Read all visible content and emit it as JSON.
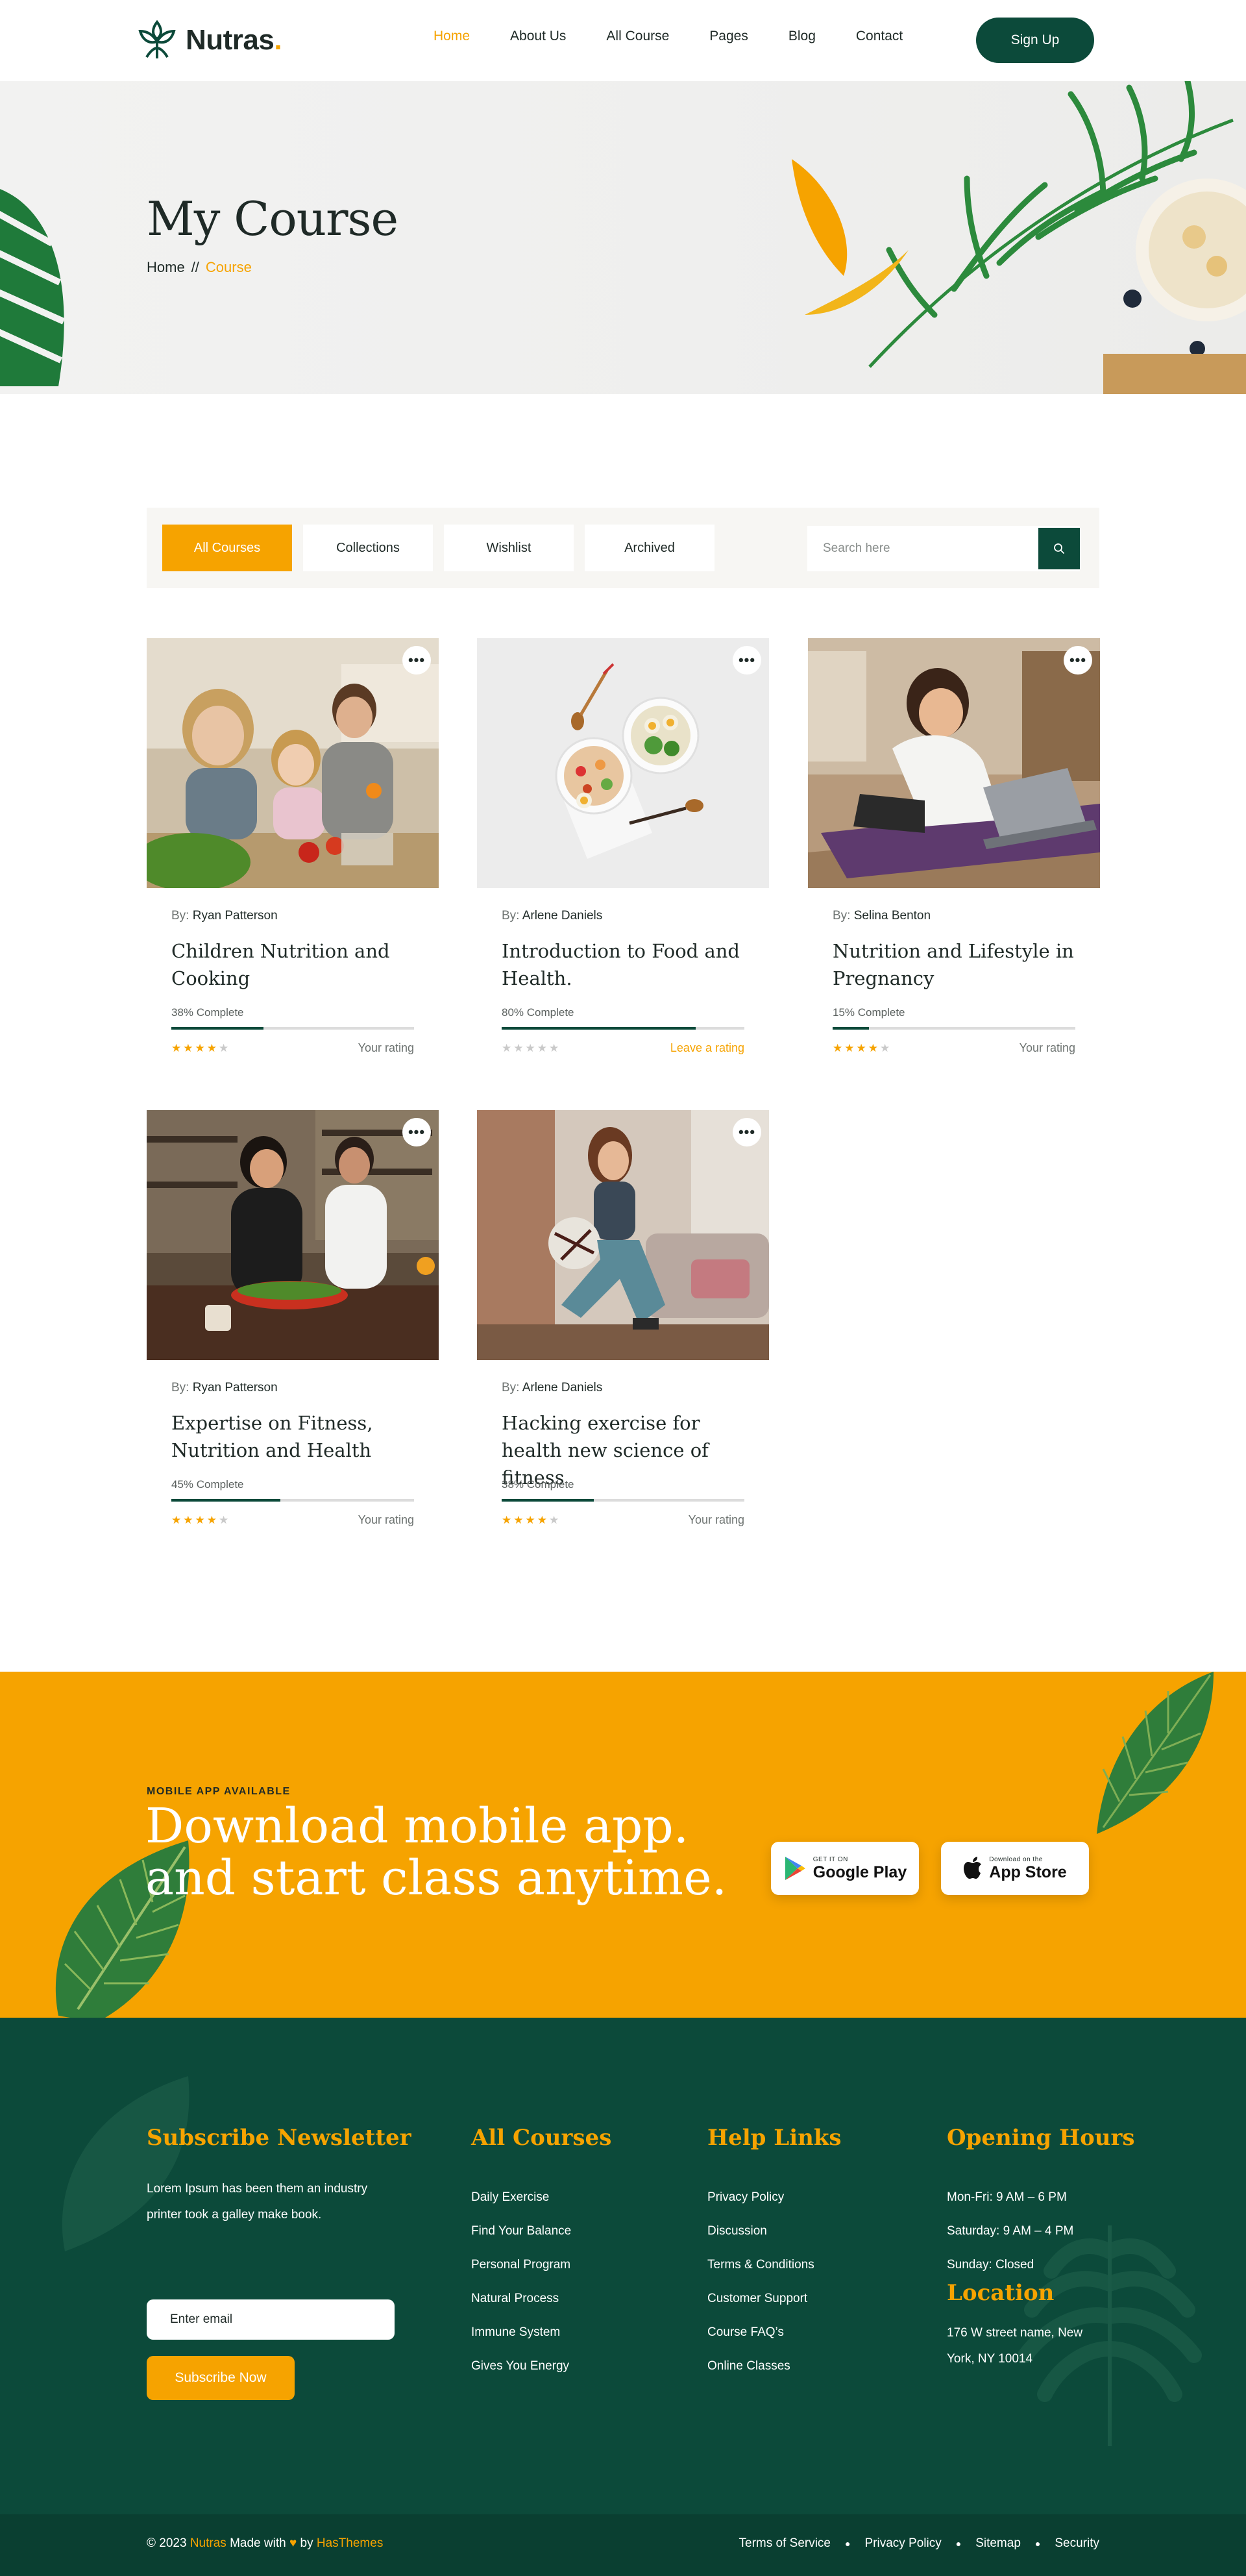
{
  "brand": {
    "name": "Nutras",
    "dot": ".",
    "accent": "#f6a300",
    "primary": "#0c4a3a"
  },
  "nav": {
    "items": [
      {
        "label": "Home",
        "active": true
      },
      {
        "label": "About Us"
      },
      {
        "label": "All Course"
      },
      {
        "label": "Pages"
      },
      {
        "label": "Blog"
      },
      {
        "label": "Contact"
      }
    ],
    "cta": "Sign Up"
  },
  "hero": {
    "title": "My Course",
    "breadcrumb": {
      "home": "Home",
      "separator": "//",
      "current": "Course"
    }
  },
  "filters": {
    "tabs": [
      "All Courses",
      "Collections",
      "Wishlist",
      "Archived"
    ],
    "active_tab": "All Courses",
    "search_placeholder": "Search here"
  },
  "courses": [
    {
      "by": "By:",
      "author": "Ryan Patterson",
      "title": "Children Nutrition and Cooking",
      "progress_label": "38% Complete",
      "progress": 38,
      "stars": 4,
      "rating_label": "Your rating",
      "image": "family-cooking-photo"
    },
    {
      "by": "By:",
      "author": "Arlene Daniels",
      "title": "Introduction to Food and Health.",
      "progress_label": "80% Complete",
      "progress": 80,
      "stars": 0,
      "rating_label": "Leave a rating",
      "image": "salad-bowls-photo"
    },
    {
      "by": "By:",
      "author": "Selina Benton",
      "title": "Nutrition and Lifestyle in Pregnancy",
      "progress_label": "15% Complete",
      "progress": 15,
      "stars": 4,
      "rating_label": "Your rating",
      "image": "woman-laptop-yoga-photo"
    },
    {
      "by": "By:",
      "author": "Ryan Patterson",
      "title": "Expertise on Fitness, Nutrition and Health",
      "progress_label": "45% Complete",
      "progress": 45,
      "stars": 4,
      "rating_label": "Your rating",
      "image": "couple-kitchen-photo"
    },
    {
      "by": "By:",
      "author": "Arlene Daniels",
      "title": "Hacking exercise for health new science of fitness",
      "progress_label": "38% Complete",
      "progress": 38,
      "stars": 4,
      "rating_label": "Your rating",
      "image": "woman-fitness-ball-photo"
    }
  ],
  "app": {
    "eyebrow": "MOBILE APP AVAILABLE",
    "title_line1": "Download mobile app.",
    "title_line2": "and start class anytime.",
    "google": {
      "small": "GET IT ON",
      "big": "Google Play"
    },
    "apple": {
      "small": "Download on the",
      "big": "App Store"
    }
  },
  "footer": {
    "newsletter": {
      "heading": "Subscribe Newsletter",
      "text": "Lorem Ipsum has been them an industry printer took a galley make book.",
      "email_placeholder": "Enter email",
      "button": "Subscribe Now"
    },
    "courses": {
      "heading": "All Courses",
      "items": [
        "Daily Exercise",
        "Find Your Balance",
        "Personal Program",
        "Natural Process",
        "Immune System",
        "Gives You Energy"
      ]
    },
    "help": {
      "heading": "Help Links",
      "items": [
        "Privacy Policy",
        "Discussion",
        "Terms & Conditions",
        "Customer Support",
        "Course FAQ’s",
        "Online Classes"
      ]
    },
    "hours": {
      "heading": "Opening Hours",
      "items": [
        "Mon-Fri: 9 AM – 6 PM",
        "Saturday: 9 AM – 4 PM",
        "Sunday: Closed"
      ]
    },
    "location": {
      "heading": "Location",
      "address": "176 W street name, New York, NY 10014"
    }
  },
  "bottom": {
    "copy_prefix": "© 2023",
    "copy_brand": "Nutras",
    "copy_mid": "Made with",
    "copy_by": "by",
    "copy_company": "HasThemes",
    "links": [
      "Terms of Service",
      "Privacy Policy",
      "Sitemap",
      "Security"
    ]
  }
}
